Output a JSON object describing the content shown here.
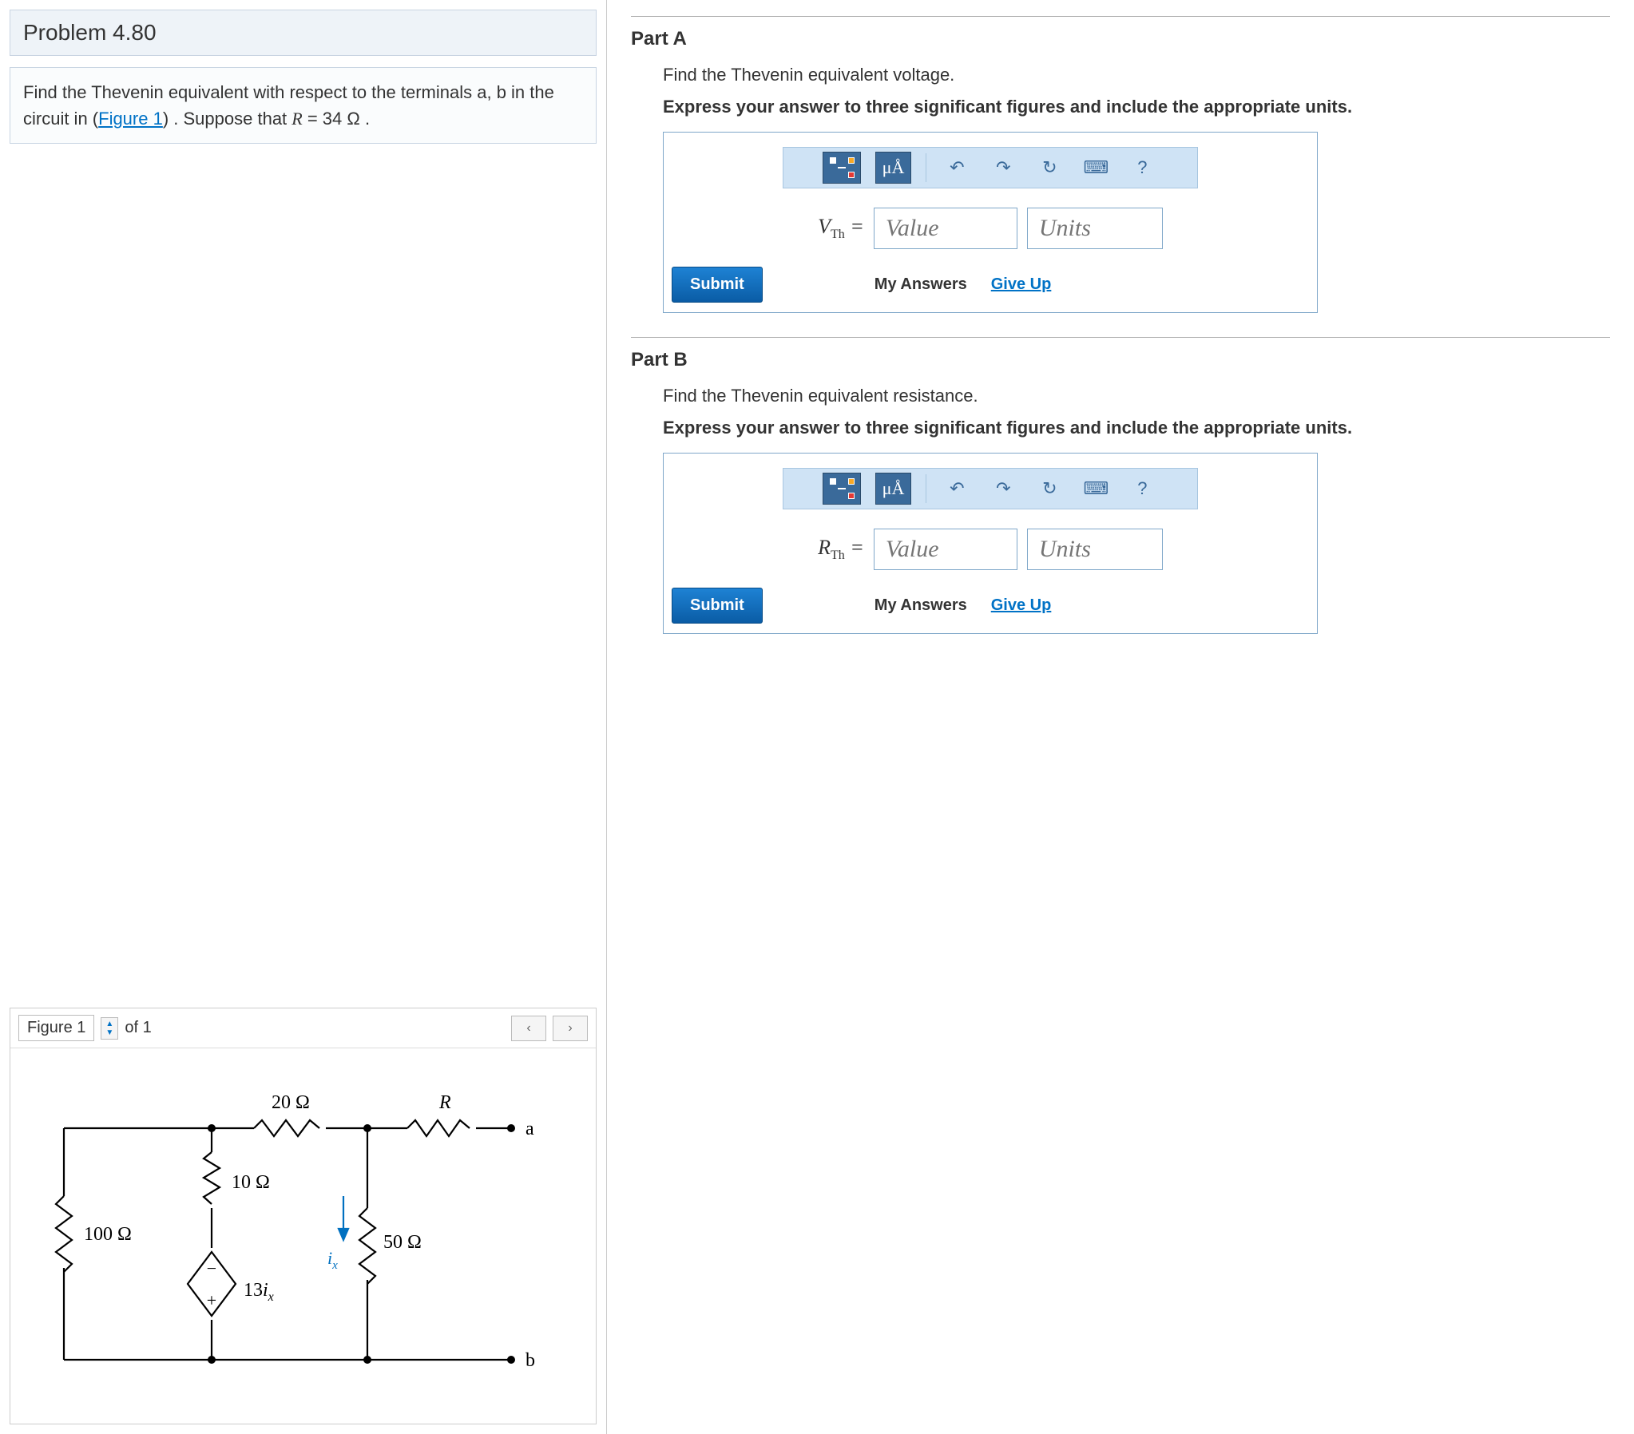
{
  "problem": {
    "number": "Problem 4.80",
    "text_prefix": "Find the Thevenin equivalent with respect to the terminals a, b in the circuit in (",
    "figure_link": "Figure 1",
    "text_mid": ") . Suppose that ",
    "R_eq": "R = 34  Ω .",
    "R_symbol": "R"
  },
  "figure": {
    "label": "Figure 1",
    "count_text": "of 1",
    "labels": {
      "R20": "20 Ω",
      "R": "R",
      "R10": "10 Ω",
      "R100": "100 Ω",
      "R50": "50 Ω",
      "ix": "ix",
      "src": "13ix",
      "a": "a",
      "b": "b"
    }
  },
  "partA": {
    "title": "Part A",
    "prompt": "Find the Thevenin equivalent voltage.",
    "instr": "Express your answer to three significant figures and include the appropriate units.",
    "var": "V",
    "sub": "Th",
    "value_ph": "Value",
    "units_ph": "Units"
  },
  "partB": {
    "title": "Part B",
    "prompt": "Find the Thevenin equivalent resistance.",
    "instr": "Express your answer to three significant figures and include the appropriate units.",
    "var": "R",
    "sub": "Th",
    "value_ph": "Value",
    "units_ph": "Units"
  },
  "toolbar": {
    "micro": "μÅ",
    "help": "?"
  },
  "actions": {
    "submit": "Submit",
    "my_answers": "My Answers",
    "give_up": "Give Up"
  }
}
